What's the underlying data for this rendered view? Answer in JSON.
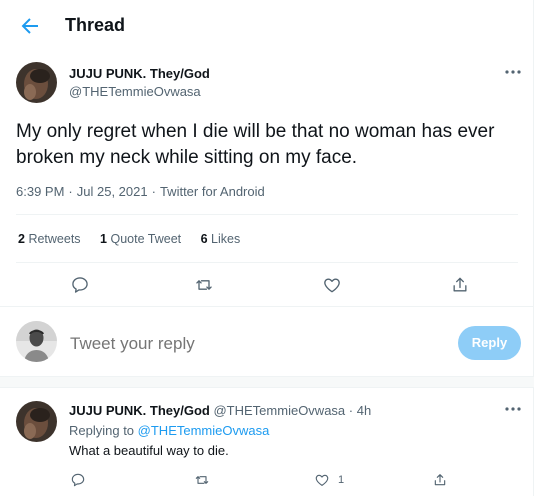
{
  "header": {
    "title": "Thread"
  },
  "tweet": {
    "author_name": "JUJU PUNK. They/God",
    "author_handle": "@THETemmieOvwasa",
    "text": "My only regret when I die will be that no woman has ever broken my neck while sitting on my face.",
    "time": "6:39 PM",
    "date": "Jul 25, 2021",
    "source": "Twitter for Android",
    "meta_sep": "·",
    "stats": {
      "retweets_count": "2",
      "retweets_label": "Retweets",
      "quotes_count": "1",
      "quotes_label": "Quote Tweet",
      "likes_count": "6",
      "likes_label": "Likes"
    }
  },
  "reply_box": {
    "placeholder": "Tweet your reply",
    "button_label": "Reply"
  },
  "reply": {
    "author_name": "JUJU PUNK. They/God",
    "author_handle": "@THETemmieOvwasa",
    "sep": "·",
    "time_ago": "4h",
    "replying_to_label": "Replying to",
    "replying_to_handle": "@THETemmieOvwasa",
    "text": "What a beautiful way to die.",
    "like_count": "1"
  },
  "colors": {
    "accent": "#1d9bf0",
    "reply_button": "#8ecdf7",
    "muted": "#536471"
  },
  "icons": [
    "back-arrow-icon",
    "more-icon",
    "reply-icon",
    "retweet-icon",
    "like-icon",
    "share-icon"
  ]
}
